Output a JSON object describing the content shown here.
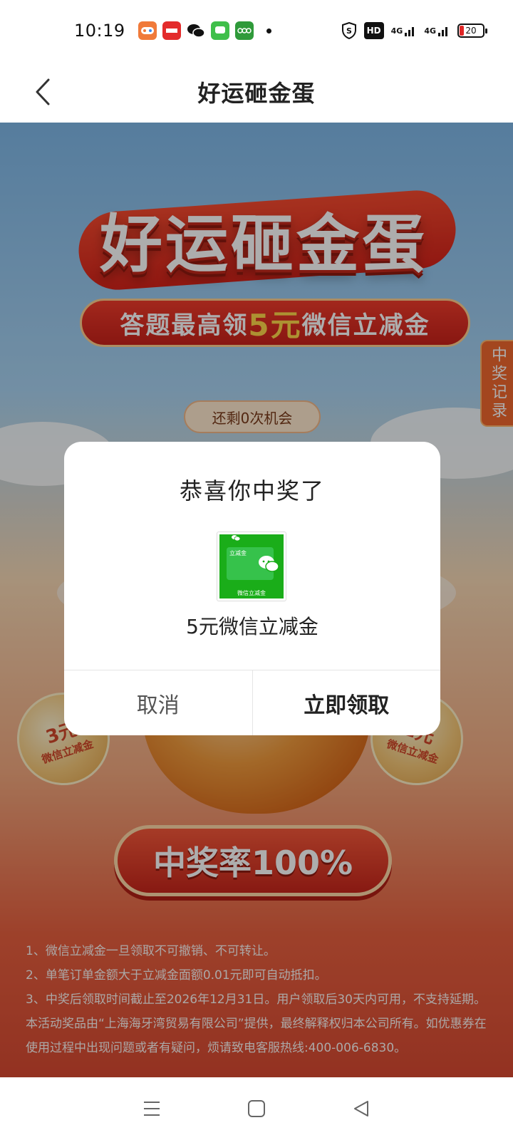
{
  "status_bar": {
    "time": "10:19",
    "apps": [
      "game-app-icon",
      "news-app-icon",
      "wechat-icon",
      "message-app-icon",
      "oppo-app-icon"
    ],
    "hd_label": "HD",
    "net1": "4G",
    "net2": "4G",
    "battery_level": "20"
  },
  "nav": {
    "title": "好运砸金蛋"
  },
  "banner": {
    "title": "好运砸金蛋",
    "subtitle_prefix": "答题最高领",
    "subtitle_highlight": "5元",
    "subtitle_suffix": "微信立减金"
  },
  "game": {
    "chances": "还剩0次机会",
    "side_tab": "中奖记录",
    "coin_left_amount": "3元",
    "coin_left_label": "微信立减金",
    "coin_right_amount": "1元",
    "coin_right_label": "微信立减金",
    "rate_button": "中奖率100%"
  },
  "rules": [
    "1、微信立减金一旦领取不可撤销、不可转让。",
    "2、单笔订单金额大于立减金面额0.01元即可自动抵扣。",
    "3、中奖后领取时间截止至2026年12月31日。用户领取后30天内可用，不支持延期。",
    "本活动奖品由“上海海牙湾贸易有限公司”提供，最终解释权归本公司所有。如优惠券在使用过程中出现问题或者有疑问，烦请致电客服热线:400-006-6830。"
  ],
  "dialog": {
    "title": "恭喜你中奖了",
    "prize_card_label": "立减金",
    "prize_card_bottom": "微信立减金",
    "prize_name": "5元微信立减金",
    "cancel": "取消",
    "claim": "立即领取"
  },
  "colors": {
    "accent_red": "#d5231a",
    "wechat_green": "#1aad19",
    "highlight_yellow": "#ffd84a"
  }
}
